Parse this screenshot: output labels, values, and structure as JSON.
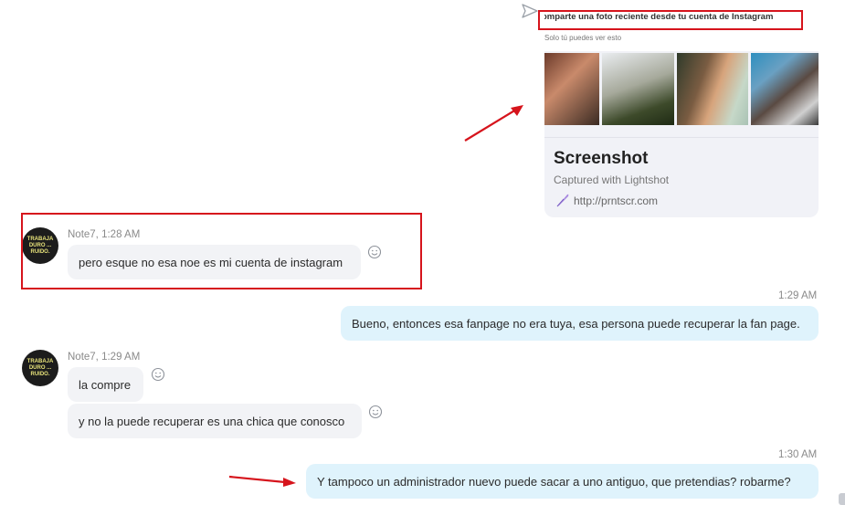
{
  "link_card": {
    "preview_title": "omparte una foto reciente desde tu cuenta de Instagram",
    "preview_subtitle": "Solo tú puedes ver esto",
    "title": "Screenshot",
    "description": "Captured with Lightshot",
    "url": "http://prntscr.com",
    "link_icon": "feather-pen-icon",
    "share_icon": "send-arrow-icon"
  },
  "messages": [
    {
      "sender": "Note7, 1:28 AM",
      "avatar_text": "TRABAJA DURO ... RUIDO.",
      "bubbles": [
        "pero esque no esa noe es mi cuenta de instagram"
      ]
    },
    {
      "time": "1:29 AM",
      "outgoing": "Bueno, entonces esa fanpage no era tuya, esa persona puede recuperar la fan page."
    },
    {
      "sender": "Note7, 1:29 AM",
      "avatar_text": "TRABAJA DURO ... RUIDO.",
      "bubbles": [
        "la compre",
        "y no la puede recuperar es una chica que conosco"
      ]
    },
    {
      "time": "1:30 AM",
      "outgoing": "Y tampoco un administrador nuevo puede sacar a uno antiguo, que pretendias? robarme?"
    }
  ],
  "colors": {
    "incoming_bubble": "#f2f3f6",
    "outgoing_bubble": "#dff3fc",
    "highlight": "#d6141c"
  }
}
